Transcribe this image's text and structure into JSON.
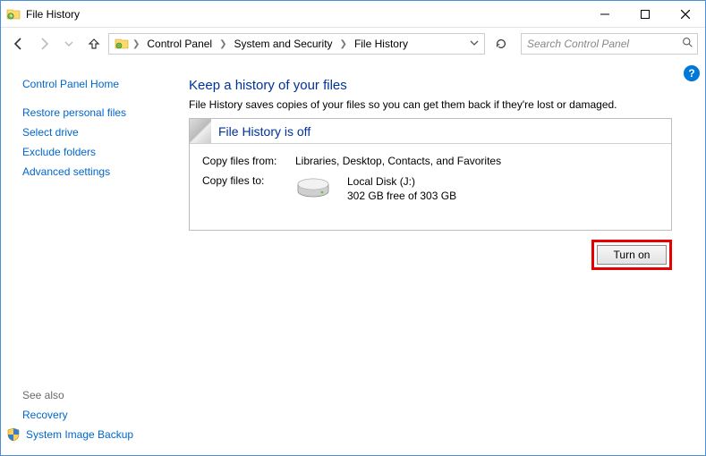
{
  "window": {
    "title": "File History"
  },
  "breadcrumbs": {
    "items": [
      "Control Panel",
      "System and Security",
      "File History"
    ]
  },
  "search": {
    "placeholder": "Search Control Panel"
  },
  "sidebar": {
    "home": "Control Panel Home",
    "links": [
      "Restore personal files",
      "Select drive",
      "Exclude folders",
      "Advanced settings"
    ],
    "see_also_label": "See also",
    "see_also": [
      "Recovery",
      "System Image Backup"
    ]
  },
  "content": {
    "heading": "Keep a history of your files",
    "description": "File History saves copies of your files so you can get them back if they're lost or damaged.",
    "panel": {
      "status": "File History is off",
      "copy_from_label": "Copy files from:",
      "copy_from_value": "Libraries, Desktop, Contacts, and Favorites",
      "copy_to_label": "Copy files to:",
      "drive_name": "Local Disk (J:)",
      "drive_free": "302 GB free of 303 GB"
    },
    "turn_on_label": "Turn on"
  },
  "help": {
    "glyph": "?"
  }
}
